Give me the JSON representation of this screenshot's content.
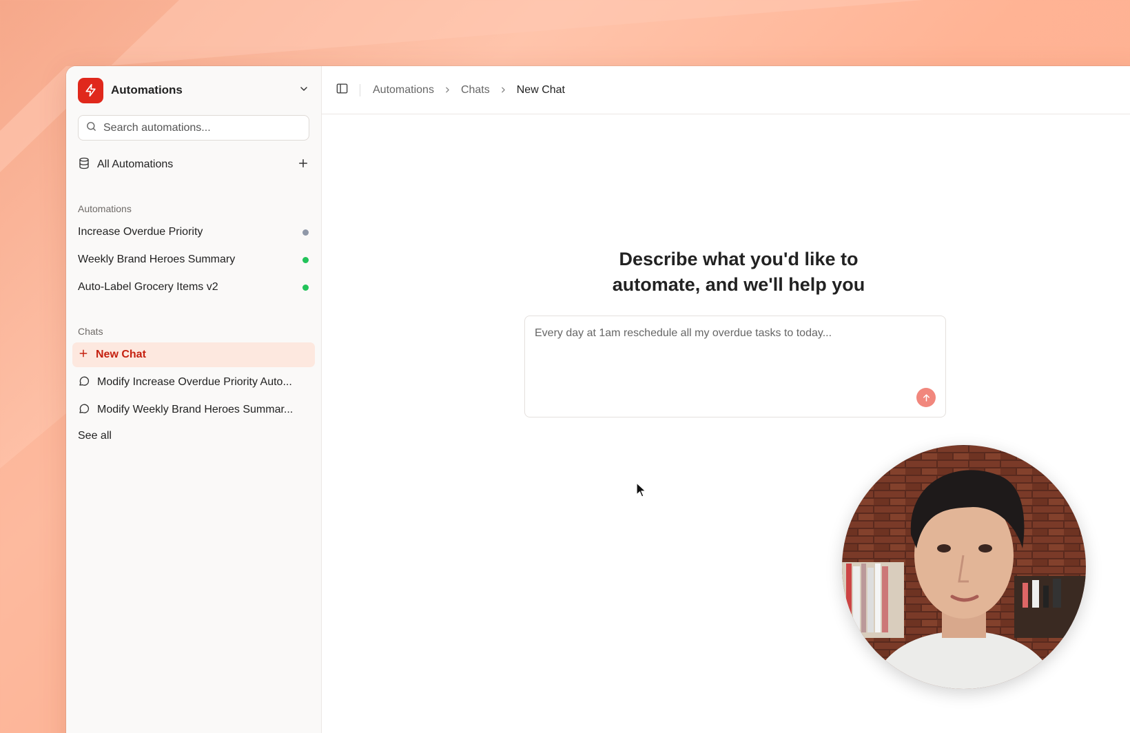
{
  "workspace": {
    "name": "Automations"
  },
  "sidebar": {
    "search_placeholder": "Search automations...",
    "all_automations_label": "All Automations",
    "automations_section_label": "Automations",
    "automations": [
      {
        "label": "Increase Overdue Priority",
        "status_color": "#8f98a8"
      },
      {
        "label": "Weekly Brand Heroes Summary",
        "status_color": "#22c35a"
      },
      {
        "label": "Auto-Label Grocery Items v2",
        "status_color": "#22c35a"
      }
    ],
    "chats_section_label": "Chats",
    "new_chat_label": "New Chat",
    "chats": [
      {
        "label": "Modify Increase Overdue Priority Auto..."
      },
      {
        "label": "Modify Weekly Brand Heroes Summar..."
      }
    ],
    "see_all_label": "See all"
  },
  "breadcrumb": {
    "items": [
      "Automations",
      "Chats"
    ],
    "current": "New Chat"
  },
  "main": {
    "headline_line1": "Describe what you'd like to",
    "headline_line2": "automate, and we'll help you",
    "composer_placeholder": "Every day at 1am reschedule all my overdue tasks to today..."
  },
  "colors": {
    "accent": "#e0281c",
    "active_bg": "#fde8df",
    "send_button": "#f1877d"
  },
  "icons": {
    "workspace": "lightning-bolt-icon",
    "dropdown": "chevron-down-icon",
    "search": "search-icon",
    "all_automations": "database-icon",
    "add": "plus-icon",
    "chat": "chat-bubble-icon",
    "sidebar_toggle": "sidebar-toggle-icon",
    "breadcrumb_separator": "chevron-right-icon",
    "send": "arrow-up-icon"
  }
}
